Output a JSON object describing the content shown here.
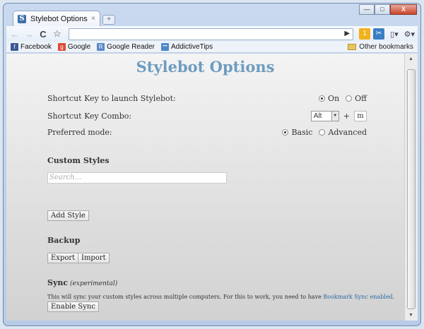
{
  "window": {
    "tab_title": "Stylebot Options",
    "tab_close": "×",
    "new_tab": "+",
    "favicon_letter": "S",
    "minimize": "—",
    "maximize": "□",
    "close": "X"
  },
  "toolbar": {
    "back": "←",
    "forward": "→",
    "reload": "C",
    "star": "☆",
    "go": "▶",
    "ext_badge": "1",
    "page_menu": "▯▾",
    "wrench": "⚙▾"
  },
  "bookmarks": {
    "items": [
      {
        "label": "Facebook",
        "glyph": "f",
        "color": "#3b5998"
      },
      {
        "label": "Google",
        "glyph": "g",
        "color": "#dd4b39"
      },
      {
        "label": "Google Reader",
        "glyph": "R",
        "color": "#5a87c6"
      },
      {
        "label": "AddictiveTips",
        "glyph": "•••",
        "color": "#4f86c6"
      }
    ],
    "other": "Other bookmarks"
  },
  "page": {
    "title": "Stylebot Options",
    "shortcut_label": "Shortcut Key to launch Stylebot:",
    "on_label": "On",
    "off_label": "Off",
    "combo_label": "Shortcut Key Combo:",
    "combo_modifier": "Alt",
    "combo_plus": "+",
    "combo_key": "m",
    "mode_label": "Preferred mode:",
    "basic_label": "Basic",
    "advanced_label": "Advanced",
    "custom_styles_heading": "Custom Styles",
    "search_placeholder": "Search...",
    "add_style": "Add Style",
    "backup_heading": "Backup",
    "export": "Export",
    "import": "Import",
    "sync_heading": "Sync",
    "sync_sub": "(experimental)",
    "sync_text": "This will sync your custom styles across multiple computers. For this to work, you need to have ",
    "sync_link": "Bookmark Sync enabled",
    "sync_end": ".",
    "enable_sync": "Enable Sync"
  }
}
